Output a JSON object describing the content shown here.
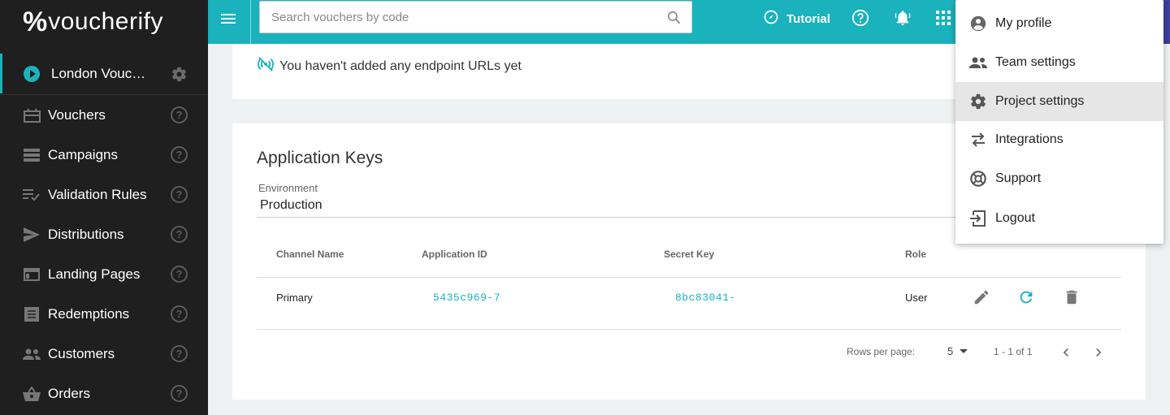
{
  "brand": {
    "logo_mark": "%",
    "logo_text": "voucherify"
  },
  "sidebar": {
    "project_name": "London Voucherify",
    "items": [
      {
        "label": "Vouchers",
        "icon": "gift-card-icon"
      },
      {
        "label": "Campaigns",
        "icon": "campaigns-icon"
      },
      {
        "label": "Validation Rules",
        "icon": "checklist-icon"
      },
      {
        "label": "Distributions",
        "icon": "send-icon"
      },
      {
        "label": "Landing Pages",
        "icon": "web-page-icon"
      },
      {
        "label": "Redemptions",
        "icon": "receipt-icon"
      },
      {
        "label": "Customers",
        "icon": "people-icon"
      },
      {
        "label": "Orders",
        "icon": "basket-icon"
      }
    ],
    "help_glyph": "?"
  },
  "topbar": {
    "search_placeholder": "Search vouchers by code",
    "tutorial_label": "Tutorial"
  },
  "webhooks": {
    "empty_text": "You haven't added any endpoint URLs yet"
  },
  "app_keys": {
    "title": "Application Keys",
    "env_label": "Environment",
    "env_value": "Production",
    "columns": [
      "Channel Name",
      "Application ID",
      "Secret Key",
      "Role"
    ],
    "rows": [
      {
        "channel": "Primary",
        "app_id": "5435c969-7",
        "secret": "8bc83041-",
        "role": "User"
      }
    ],
    "rows_per_page_label": "Rows per page:",
    "rows_per_page_value": "5",
    "range": "1 - 1 of 1"
  },
  "user_menu": {
    "items": [
      {
        "label": "My profile",
        "icon": "account-circle-icon"
      },
      {
        "label": "Team settings",
        "icon": "team-icon"
      },
      {
        "label": "Project settings",
        "icon": "gear-icon",
        "active": true
      },
      {
        "label": "Integrations",
        "icon": "swap-arrows-icon"
      },
      {
        "label": "Support",
        "icon": "lifebuoy-icon"
      },
      {
        "label": "Logout",
        "icon": "logout-icon"
      }
    ]
  },
  "colors": {
    "accent": "#19b2bd",
    "sidebar_bg": "#1f1f1f",
    "edge": "#3b3fa0"
  }
}
